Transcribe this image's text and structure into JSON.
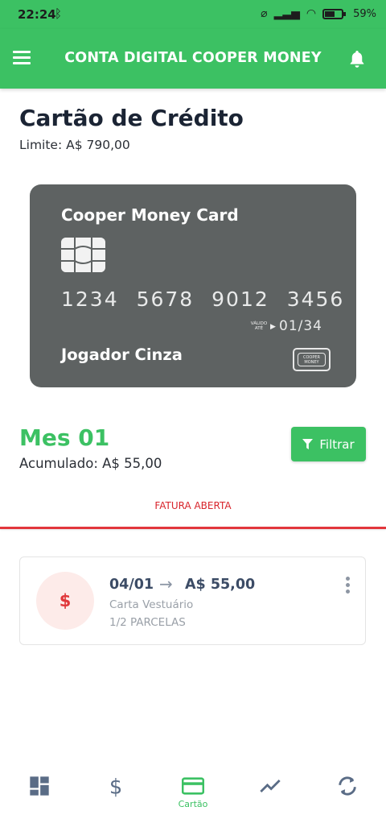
{
  "status_bar": {
    "time": "22:24",
    "battery": "59"
  },
  "app_bar": {
    "title": "CONTA DIGITAL COOPER MONEY"
  },
  "page": {
    "title": "Cartão de Crédito",
    "limit": "Limite: A$ 790,00"
  },
  "card": {
    "brand_name": "Cooper Money Card",
    "number": "1234 5678 9012 3456",
    "valid_label": "VÁLIDO ATÉ",
    "valid_thru": "01/34",
    "holder": "Jogador Cinza",
    "logo_text": "COOPER MONEY",
    "color": "#5e6262"
  },
  "month": {
    "label": "Mes 01",
    "accumulated": "Acumulado: A$ 55,00",
    "filter_label": "Filtrar"
  },
  "invoice_status": "FATURA ABERTA",
  "transactions": [
    {
      "icon": "$",
      "date": "04/01",
      "amount": "A$ 55,00",
      "description": "Carta Vestuário",
      "installments": "1/2 PARCELAS"
    }
  ],
  "bottom_nav": {
    "items": [
      {
        "icon": "dashboard-icon"
      },
      {
        "icon": "dollar-icon"
      },
      {
        "icon": "credit-card-icon",
        "label": "Cartão",
        "active": true
      },
      {
        "icon": "trending-up-icon"
      },
      {
        "icon": "sync-icon"
      }
    ]
  },
  "colors": {
    "primary": "#3cc163",
    "danger": "#e2363c",
    "text_dark": "#1b2434"
  }
}
